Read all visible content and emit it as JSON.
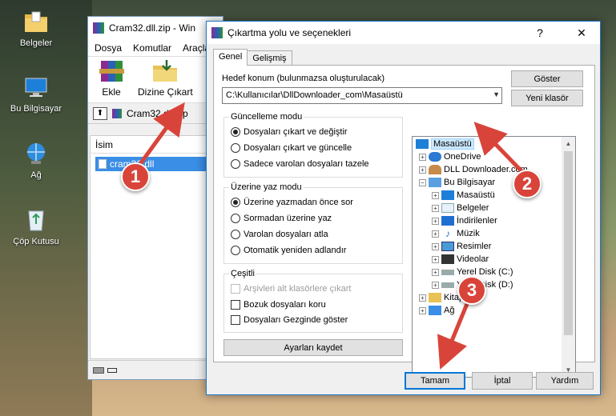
{
  "desktop": {
    "icons": [
      {
        "label": "Belgeler"
      },
      {
        "label": "Bu Bilgisayar"
      },
      {
        "label": "Ağ"
      },
      {
        "label": "Çöp Kutusu"
      }
    ]
  },
  "winrar": {
    "title": "Cram32.dll.zip - Win",
    "menu": [
      "Dosya",
      "Komutlar",
      "Araçla"
    ],
    "toolbar": {
      "add_label": "Ekle",
      "extract_label": "Dizine Çıkart"
    },
    "path": "Cram32.dll.zip",
    "column_name": "İsim",
    "file_name": "cram32.dll"
  },
  "dialog": {
    "title": "Çıkartma yolu ve seçenekleri",
    "help_symbol": "?",
    "close_symbol": "✕",
    "tabs": {
      "general": "Genel",
      "advanced": "Gelişmiş"
    },
    "dest_label": "Hedef konum (bulunmazsa oluşturulacak)",
    "dest_value": "C:\\Kullanıcılar\\DllDownloader_com\\Masaüstü",
    "show_button": "Göster",
    "new_folder_button": "Yeni klasör",
    "update_mode": {
      "title": "Güncelleme modu",
      "options": [
        {
          "label": "Dosyaları çıkart ve değiştir",
          "selected": true
        },
        {
          "label": "Dosyaları çıkart ve güncelle",
          "selected": false
        },
        {
          "label": "Sadece varolan dosyaları tazele",
          "selected": false
        }
      ]
    },
    "overwrite_mode": {
      "title": "Üzerine yaz modu",
      "options": [
        {
          "label": "Üzerine yazmadan önce sor",
          "selected": true
        },
        {
          "label": "Sormadan üzerine yaz",
          "selected": false
        },
        {
          "label": "Varolan dosyaları atla",
          "selected": false
        },
        {
          "label": "Otomatik yeniden adlandır",
          "selected": false
        }
      ]
    },
    "misc": {
      "title": "Çeşitli",
      "options": [
        {
          "label": "Arşivleri alt klasörlere çıkart",
          "checked": false,
          "disabled": true
        },
        {
          "label": "Bozuk dosyaları koru",
          "checked": false,
          "disabled": false
        },
        {
          "label": "Dosyaları Gezginde göster",
          "checked": false,
          "disabled": false
        }
      ]
    },
    "save_settings": "Ayarları kaydet",
    "tree": [
      {
        "label": "Masaüstü",
        "selected": true
      },
      {
        "label": "OneDrive"
      },
      {
        "label": "DLL Downloader.com"
      },
      {
        "label": "Bu Bilgisayar"
      },
      {
        "label": "Masaüstü"
      },
      {
        "label": "Belgeler"
      },
      {
        "label": "İndirilenler"
      },
      {
        "label": "Müzik"
      },
      {
        "label": "Resimler"
      },
      {
        "label": "Videolar"
      },
      {
        "label": "Yerel Disk (C:)"
      },
      {
        "label": "Yerel Disk (D:)"
      },
      {
        "label": "Kitaplıklar"
      },
      {
        "label": "Ağ"
      }
    ],
    "ok_button": "Tamam",
    "cancel_button": "İptal",
    "help_button": "Yardım"
  },
  "annotations": {
    "step1": "1",
    "step2": "2",
    "step3": "3",
    "badge_color": "#d9443a"
  }
}
